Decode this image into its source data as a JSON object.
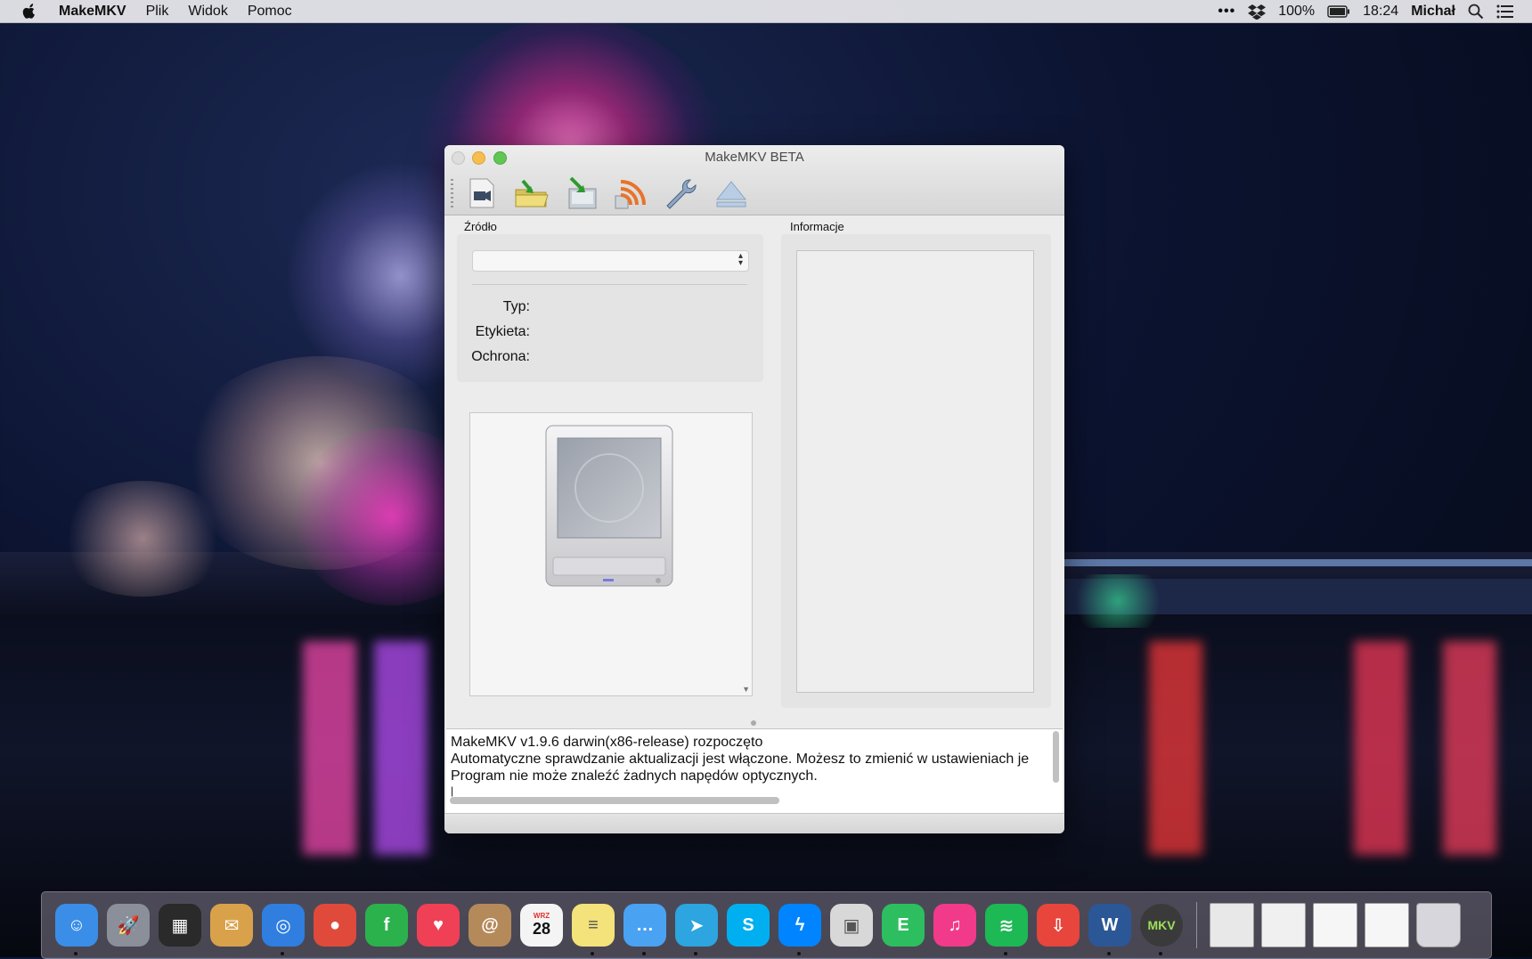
{
  "menubar": {
    "app_name": "MakeMKV",
    "items": [
      "Plik",
      "Widok",
      "Pomoc"
    ],
    "battery": "100%",
    "time": "18:24",
    "user": "Michał",
    "icons": [
      "apple-icon",
      "more-icon",
      "dropbox-icon",
      "battery-icon",
      "spotlight-icon",
      "notification-center-icon"
    ]
  },
  "window": {
    "title": "MakeMKV BETA",
    "toolbar": [
      {
        "name": "open-disc-icon"
      },
      {
        "name": "open-files-icon"
      },
      {
        "name": "backup-icon"
      },
      {
        "name": "stream-icon"
      },
      {
        "name": "preferences-icon"
      },
      {
        "name": "eject-icon"
      }
    ],
    "source": {
      "heading": "Źródło",
      "selected": "",
      "fields": [
        "Typ:",
        "Etykieta:",
        "Ochrona:"
      ]
    },
    "info": {
      "heading": "Informacje"
    },
    "log": [
      "MakeMKV v1.9.6 darwin(x86-release) rozpoczęto",
      "Automatyczne sprawdzanie aktualizacji jest włączone. Możesz to zmienić w ustawieniach je",
      "Program nie może znaleźć żadnych napędów optycznych.",
      "|"
    ]
  },
  "dock": {
    "apps": [
      {
        "name": "finder",
        "color": "#3a8ee8",
        "glyph": "☺",
        "running": true
      },
      {
        "name": "launchpad",
        "color": "#8a8f99",
        "glyph": "🚀",
        "running": false
      },
      {
        "name": "mission-control",
        "color": "#2a2a2a",
        "glyph": "▦",
        "running": false
      },
      {
        "name": "mail",
        "color": "#d9a24a",
        "glyph": "✉",
        "running": false
      },
      {
        "name": "safari",
        "color": "#2f7ee0",
        "glyph": "◎",
        "running": true
      },
      {
        "name": "chrome",
        "color": "#e04a3a",
        "glyph": "●",
        "running": false
      },
      {
        "name": "feedly",
        "color": "#2bb24c",
        "glyph": "f",
        "running": false
      },
      {
        "name": "pocket",
        "color": "#ef4056",
        "glyph": "♥",
        "running": false
      },
      {
        "name": "contacts",
        "color": "#b58a5b",
        "glyph": "@",
        "running": false
      },
      {
        "name": "calendar",
        "color": "#f4f4f4",
        "glyph": "28",
        "running": false
      },
      {
        "name": "notes",
        "color": "#f4e27a",
        "glyph": "≡",
        "running": true
      },
      {
        "name": "messages",
        "color": "#4aa2f2",
        "glyph": "…",
        "running": true
      },
      {
        "name": "telegram",
        "color": "#2ca5e0",
        "glyph": "➤",
        "running": true
      },
      {
        "name": "skype",
        "color": "#00aff0",
        "glyph": "S",
        "running": false
      },
      {
        "name": "messenger",
        "color": "#0084ff",
        "glyph": "ϟ",
        "running": true
      },
      {
        "name": "preview",
        "color": "#d8d8d8",
        "glyph": "▣",
        "running": false
      },
      {
        "name": "evernote",
        "color": "#2dbe60",
        "glyph": "E",
        "running": false
      },
      {
        "name": "itunes",
        "color": "#f23a8a",
        "glyph": "♫",
        "running": false
      },
      {
        "name": "spotify",
        "color": "#1db954",
        "glyph": "≋",
        "running": true
      },
      {
        "name": "transmit",
        "color": "#e8453c",
        "glyph": "⇩",
        "running": false
      },
      {
        "name": "word",
        "color": "#2b5797",
        "glyph": "W",
        "running": true
      },
      {
        "name": "makemkv",
        "color": "#3a3a3a",
        "glyph": "MKV",
        "running": true
      }
    ],
    "right_items": [
      {
        "name": "minimized-window-1",
        "color": "#e8e8e8"
      },
      {
        "name": "minimized-window-2",
        "color": "#f0f0f0"
      },
      {
        "name": "documents-stack",
        "color": "#f6f6f6"
      },
      {
        "name": "downloads-stack",
        "color": "#f6f6f6"
      },
      {
        "name": "trash",
        "color": "#d6d6dc"
      }
    ],
    "calendar_month": "WRZ",
    "calendar_day": "28"
  }
}
